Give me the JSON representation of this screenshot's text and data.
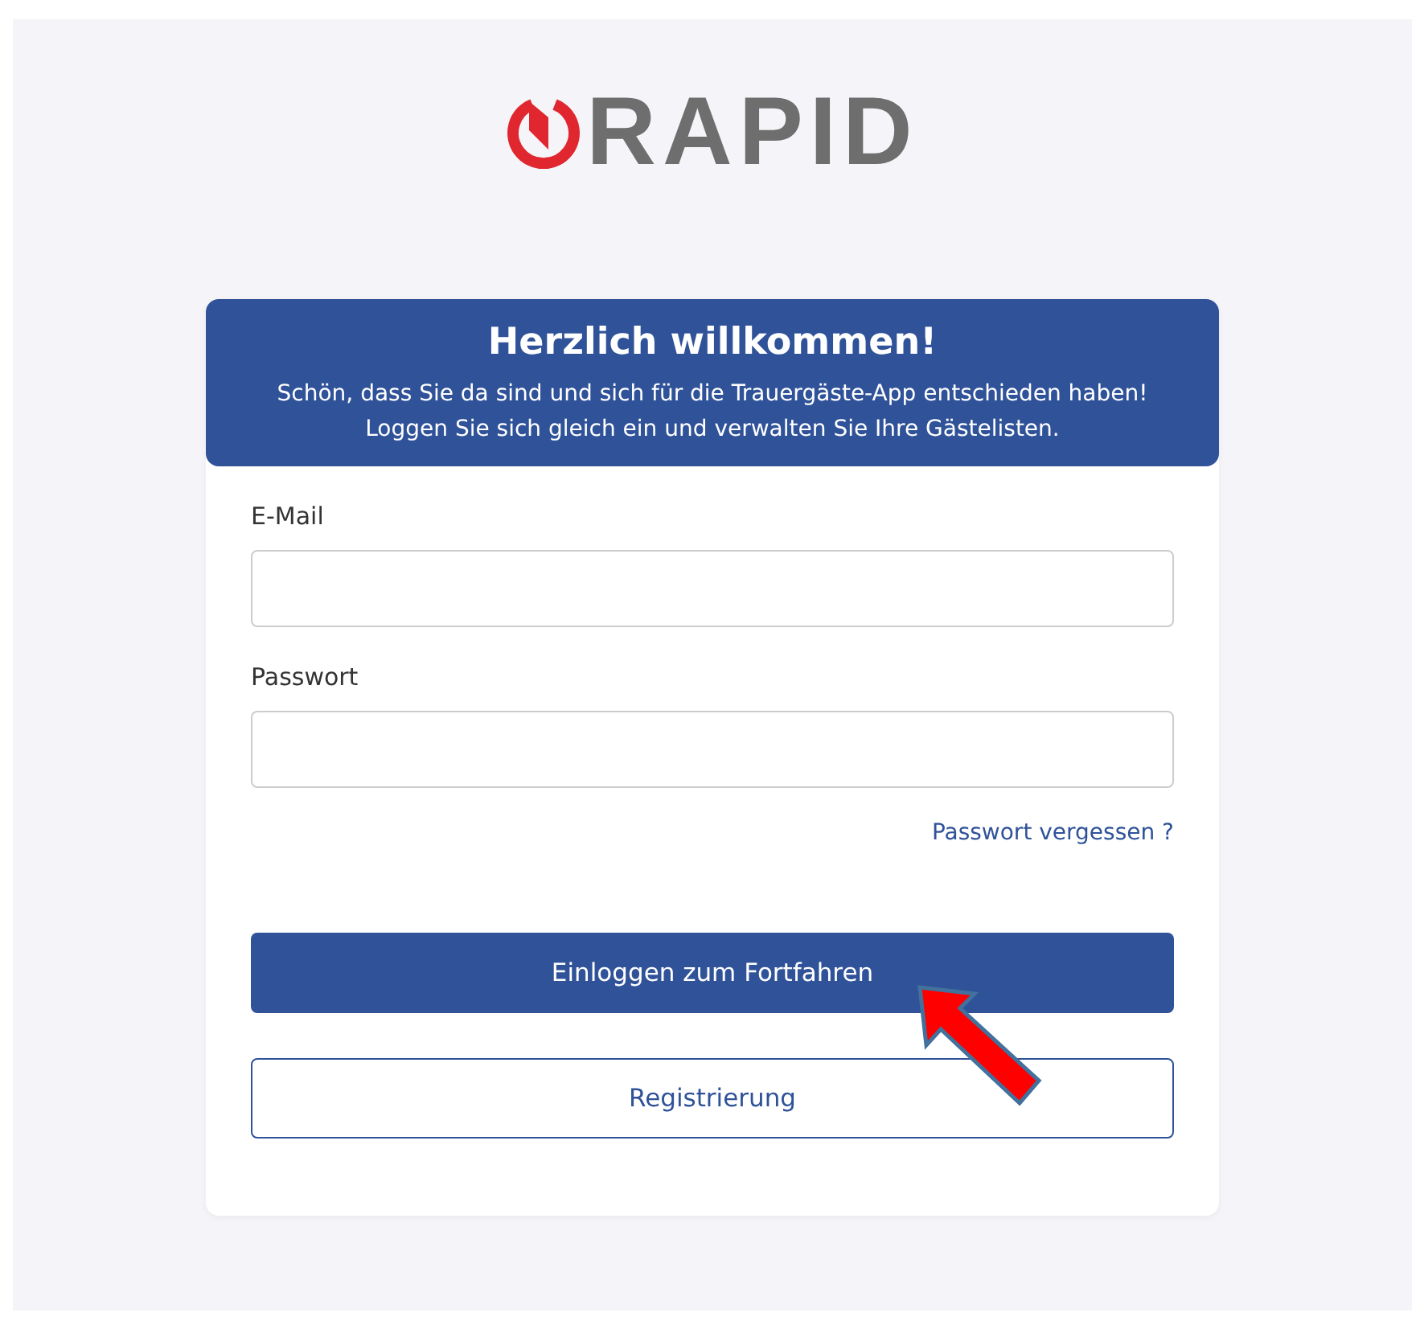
{
  "logo": {
    "text": "RAPID"
  },
  "header": {
    "title": "Herzlich willkommen!",
    "subtitle": "Schön, dass Sie da sind und sich für die Trauergäste-App entschieden haben! Loggen Sie sich gleich ein und verwalten Sie Ihre Gästelisten."
  },
  "fields": [
    {
      "label": "E-Mail"
    },
    {
      "label": "Passwort"
    }
  ],
  "forgot_link": "Passwort vergessen ?",
  "buttons": [
    {
      "label": "Einloggen zum Fortfahren",
      "kind": "primary"
    },
    {
      "label": "Registrierung",
      "kind": "outline"
    }
  ]
}
